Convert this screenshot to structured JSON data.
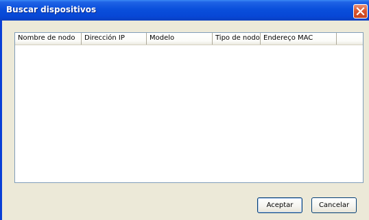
{
  "window": {
    "title": "Buscar dispositivos",
    "close_icon": "close-icon"
  },
  "list": {
    "columns": [
      "Nombre de nodo",
      "Dirección IP",
      "Modelo",
      "Tipo de nodo",
      "Endereço MAC"
    ],
    "rows": []
  },
  "buttons": {
    "ok_label": "Aceptar",
    "cancel_label": "Cancelar"
  },
  "colors": {
    "titlebar": "#0a4fdb",
    "client_bg": "#ece9d8",
    "close_button": "#d9562f"
  }
}
